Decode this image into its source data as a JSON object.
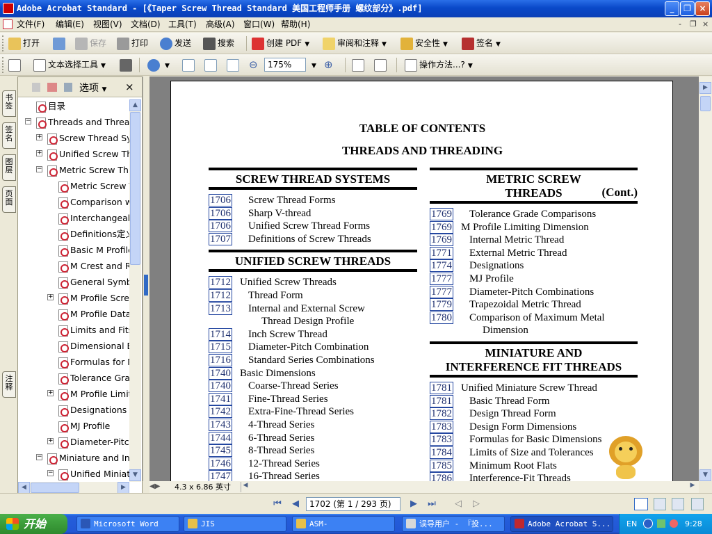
{
  "window": {
    "title": "Adobe Acrobat Standard - [《Taper Screw Thread Standard 美国工程师手册 螺纹部分》.pdf]",
    "controls": [
      "_",
      "❐",
      "×"
    ]
  },
  "menu": {
    "items": [
      "文件(F)",
      "编辑(E)",
      "视图(V)",
      "文档(D)",
      "工具(T)",
      "高级(A)",
      "窗口(W)",
      "帮助(H)"
    ],
    "doc_controls": [
      "-",
      "❐",
      "×"
    ]
  },
  "toolbar1": {
    "open": "打开",
    "save": "保存",
    "print": "打印",
    "send": "发送",
    "search": "搜索",
    "create_pdf": "创建 PDF",
    "review": "审阅和注释",
    "security": "安全性",
    "sign": "签名"
  },
  "toolbar2": {
    "text_select": "文本选择工具",
    "zoom": "175%",
    "howto": "操作方法...?"
  },
  "nav_tabs": [
    "书签",
    "签名",
    "图层",
    "页面",
    "注释"
  ],
  "bookmarks": {
    "options_label": "选项",
    "items": [
      {
        "label": "目录",
        "level": 0,
        "expander": ""
      },
      {
        "label": "Threads and Threading",
        "level": 0,
        "expander": "−"
      },
      {
        "label": "Screw Thread Systems",
        "level": 1,
        "expander": "+"
      },
      {
        "label": "Unified Screw Threads",
        "level": 1,
        "expander": "+"
      },
      {
        "label": "Metric Screw Threads",
        "level": 1,
        "expander": "−"
      },
      {
        "label": "Metric Screw Threads",
        "level": 2,
        "expander": ""
      },
      {
        "label": "Comparison with",
        "level": 2,
        "expander": ""
      },
      {
        "label": "Interchangeability",
        "level": 2,
        "expander": ""
      },
      {
        "label": "Definitions定义",
        "level": 2,
        "expander": ""
      },
      {
        "label": "Basic M Profile",
        "level": 2,
        "expander": ""
      },
      {
        "label": "M Crest and Root",
        "level": 2,
        "expander": ""
      },
      {
        "label": "General Symbols",
        "level": 2,
        "expander": ""
      },
      {
        "label": "M Profile Screw",
        "level": 2,
        "expander": "+"
      },
      {
        "label": "M Profile Data",
        "level": 2,
        "expander": ""
      },
      {
        "label": "Limits and Fits",
        "level": 2,
        "expander": ""
      },
      {
        "label": "Dimensional Effects",
        "level": 2,
        "expander": ""
      },
      {
        "label": "Formulas for M",
        "level": 2,
        "expander": ""
      },
      {
        "label": "Tolerance Grade",
        "level": 2,
        "expander": ""
      },
      {
        "label": "M Profile Limiting",
        "level": 2,
        "expander": "+"
      },
      {
        "label": "Designations",
        "level": 2,
        "expander": ""
      },
      {
        "label": "MJ Profile",
        "level": 2,
        "expander": ""
      },
      {
        "label": "Diameter-Pitch",
        "level": 2,
        "expander": "+"
      },
      {
        "label": "Miniature and Interference",
        "level": 1,
        "expander": "−"
      },
      {
        "label": "Unified Miniature",
        "level": 2,
        "expander": "−"
      }
    ]
  },
  "document": {
    "title": "TABLE OF CONTENTS",
    "subtitle": "THREADS AND THREADING",
    "left": [
      {
        "heading": "SCREW THREAD SYSTEMS",
        "rows": [
          {
            "page": "1706",
            "text": "Screw Thread Forms",
            "indent": 1
          },
          {
            "page": "1706",
            "text": "Sharp V-thread",
            "indent": 1
          },
          {
            "page": "1706",
            "text": "Unified Screw Thread Forms",
            "indent": 1
          },
          {
            "page": "1707",
            "text": "Definitions of Screw Threads",
            "indent": 1
          }
        ]
      },
      {
        "heading": "UNIFIED SCREW THREADS",
        "rows": [
          {
            "page": "1712",
            "text": "Unified Screw Threads",
            "indent": 0
          },
          {
            "page": "1712",
            "text": "Thread Form",
            "indent": 1
          },
          {
            "page": "1713",
            "text": "Internal and External Screw",
            "indent": 1
          },
          {
            "page": "",
            "text": "Thread Design Profile",
            "indent": 2
          },
          {
            "page": "1714",
            "text": "Inch Screw Thread",
            "indent": 1
          },
          {
            "page": "1715",
            "text": "Diameter-Pitch Combination",
            "indent": 1
          },
          {
            "page": "1716",
            "text": "Standard Series Combinations",
            "indent": 1
          },
          {
            "page": "1740",
            "text": "Basic Dimensions",
            "indent": 0
          },
          {
            "page": "1740",
            "text": "Coarse-Thread Series",
            "indent": 1
          },
          {
            "page": "1741",
            "text": "Fine-Thread Series",
            "indent": 1
          },
          {
            "page": "1742",
            "text": "Extra-Fine-Thread Series",
            "indent": 1
          },
          {
            "page": "1743",
            "text": "4-Thread Series",
            "indent": 1
          },
          {
            "page": "1744",
            "text": "6-Thread Series",
            "indent": 1
          },
          {
            "page": "1745",
            "text": "8-Thread Series",
            "indent": 1
          },
          {
            "page": "1746",
            "text": "12-Thread Series",
            "indent": 1
          },
          {
            "page": "1747",
            "text": "16-Thread Series",
            "indent": 1
          }
        ]
      }
    ],
    "right": [
      {
        "heading_lines": [
          "METRIC SCREW",
          "THREADS"
        ],
        "heading_cont": "(Cont.)",
        "rows": [
          {
            "page": "1769",
            "text": "Tolerance Grade Comparisons",
            "indent": 1
          },
          {
            "page": "1769",
            "text": "M Profile Limiting Dimension",
            "indent": 0
          },
          {
            "page": "1769",
            "text": "Internal Metric Thread",
            "indent": 1
          },
          {
            "page": "1771",
            "text": "External Metric Thread",
            "indent": 1
          },
          {
            "page": "1774",
            "text": "Designations",
            "indent": 1
          },
          {
            "page": "1777",
            "text": "MJ Profile",
            "indent": 1
          },
          {
            "page": "1777",
            "text": "Diameter-Pitch Combinations",
            "indent": 1
          },
          {
            "page": "1779",
            "text": "Trapezoidal Metric Thread",
            "indent": 1
          },
          {
            "page": "1780",
            "text": "Comparison of Maximum Metal",
            "indent": 1
          },
          {
            "page": "",
            "text": "Dimension",
            "indent": 2
          }
        ]
      },
      {
        "heading_lines": [
          "MINIATURE AND",
          "INTERFERENCE FIT THREADS"
        ],
        "heading_cont": "",
        "rows": [
          {
            "page": "1781",
            "text": "Unified Miniature Screw Thread",
            "indent": 0
          },
          {
            "page": "1781",
            "text": "Basic Thread Form",
            "indent": 1
          },
          {
            "page": "1782",
            "text": "Design Thread Form",
            "indent": 1
          },
          {
            "page": "1783",
            "text": "Design Form Dimensions",
            "indent": 1
          },
          {
            "page": "1783",
            "text": "Formulas for Basic Dimensions",
            "indent": 1
          },
          {
            "page": "1784",
            "text": "Limits of Size and Tolerances",
            "indent": 1
          },
          {
            "page": "1785",
            "text": "Minimum Root Flats",
            "indent": 1
          },
          {
            "page": "1786",
            "text": "Interference-Fit Threads",
            "indent": 1
          }
        ]
      }
    ]
  },
  "status": {
    "page_size": "4.3 x 6.86 英寸",
    "page_indicator": "1702 (第 1 / 293 页)"
  },
  "taskbar": {
    "start": "开始",
    "tasks": [
      {
        "label": "Microsoft Word",
        "color": "#2b57b6"
      },
      {
        "label": "JIS",
        "color": "#e8c04a"
      },
      {
        "label": "ASM-",
        "color": "#e8c04a"
      },
      {
        "label": "误导用户 - 『投...",
        "color": "#d8d8d8"
      },
      {
        "label": "Adobe Acrobat S...",
        "color": "#c0282d"
      }
    ],
    "lang": "EN",
    "clock": "9:28"
  }
}
